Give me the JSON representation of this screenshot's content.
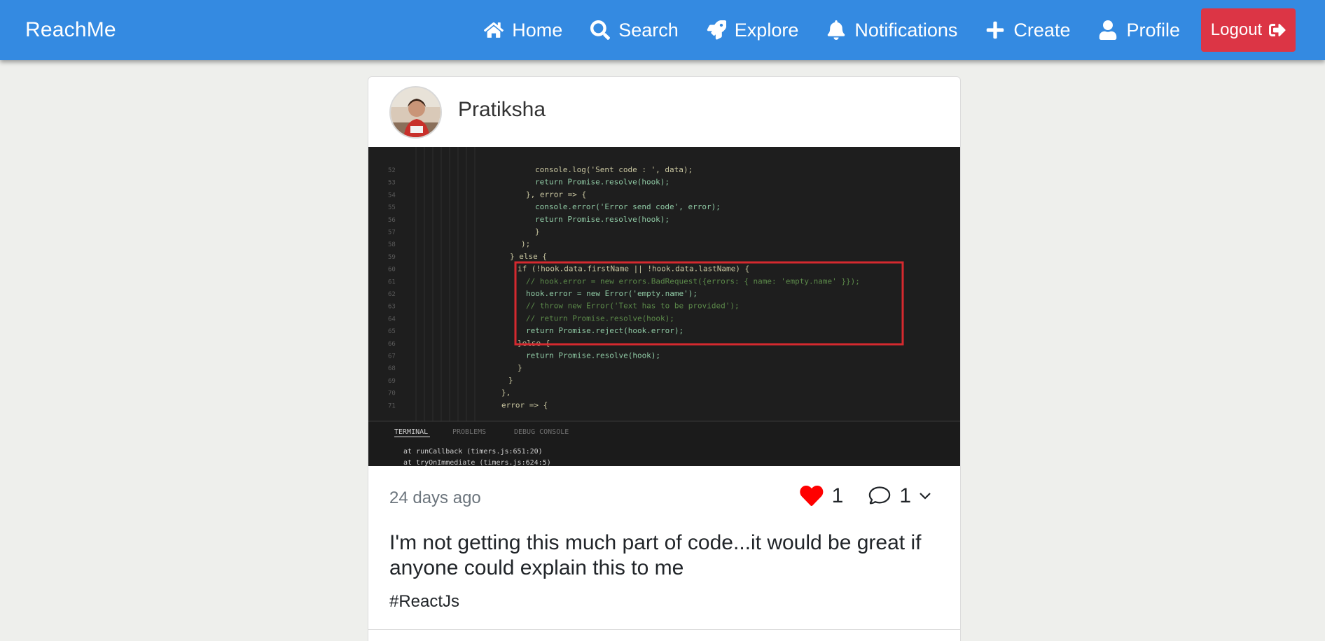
{
  "brand": "ReachMe",
  "nav": {
    "items": [
      {
        "label": "Home",
        "icon": "home-icon"
      },
      {
        "label": "Search",
        "icon": "search-icon"
      },
      {
        "label": "Explore",
        "icon": "rocket-icon"
      },
      {
        "label": "Notifications",
        "icon": "bell-icon"
      },
      {
        "label": "Create",
        "icon": "plus-icon"
      },
      {
        "label": "Profile",
        "icon": "user-icon"
      }
    ],
    "logout_label": "Logout",
    "logout_icon": "sign-out-icon"
  },
  "colors": {
    "navbar": "#348ae1",
    "logout": "#dc3545",
    "like": "#ff0000",
    "page_bg": "#eeefec"
  },
  "post": {
    "author": "Pratiksha",
    "time_ago": "24 days ago",
    "likes": "1",
    "comments": "1",
    "caption": "I'm not getting this much part of code...it would be great if anyone could explain this to me",
    "hashtag": "#ReactJs",
    "image": {
      "code_lines": [
        "console.log('Sent code : ', data);",
        "return Promise.resolve(hook);",
        "}, error => {",
        "console.error('Error send code', error);",
        "return Promise.resolve(hook);",
        "}",
        ");",
        "} else {",
        "if (!hook.data.firstName || !hook.data.lastName) {",
        "// hook.error = new errors.BadRequest({errors: { name: 'empty.name' }});",
        "hook.error = new Error('empty.name');",
        "// throw new Error('Text has to be provided');",
        "// return Promise.resolve(hook);",
        "return Promise.reject(hook.error);",
        "}else {",
        "return Promise.resolve(hook);",
        "}",
        "}",
        "},",
        "error => {"
      ],
      "panel_tabs": [
        "TERMINAL",
        "PROBLEMS",
        "DEBUG CONSOLE"
      ],
      "terminal_lines": [
        "at runCallback (timers.js:651:20)",
        "at tryOnImmediate (timers.js:624:5)"
      ]
    }
  }
}
